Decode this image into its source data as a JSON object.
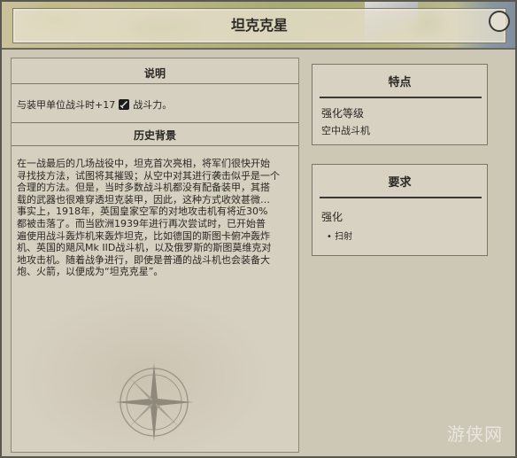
{
  "window": {
    "title": "坦克克星"
  },
  "description": {
    "heading": "说明",
    "text_before_icon": "与装甲单位战斗时+17",
    "icon": "sword-icon",
    "text_after_icon": "战斗力。"
  },
  "history": {
    "heading": "历史背景",
    "lines": [
      "在一战最后的几场战役中，坦克首次亮相，将军们很快开始",
      "寻找技方法，试图将其摧毁；从空中对其进行袭击似乎是一个",
      "合理的方法。但是，当时多数战斗机都没有配备装甲，其搭",
      "载的武器也很难穿透坦克装甲，因此，这种方式收效甚微…",
      "事实上，1918年，英国皇家空军的对地攻击机有将近30%",
      "都被击落了。而当欧洲1939年进行再次尝试时，已开始普",
      "遍使用战斗轰炸机来轰炸坦克，比如德国的斯图卡俯冲轰炸",
      "机、英国的飓风Mk IID战斗机，以及俄罗斯的斯图莫维克对",
      "地攻击机。随着战争进行，即使是普通的战斗机也会装备大",
      "炮、火箭，以便成为“坦克克星”。"
    ]
  },
  "traits": {
    "heading": "特点",
    "upgrade_label": "强化等级",
    "upgrade_value": "空中战斗机"
  },
  "requirements": {
    "heading": "要求",
    "label": "强化",
    "items": [
      "扫射"
    ]
  },
  "watermark": "游侠网",
  "colors": {
    "panel_bg": "#d6d0c1",
    "text": "#2a2823",
    "rule": "#7b766a"
  }
}
